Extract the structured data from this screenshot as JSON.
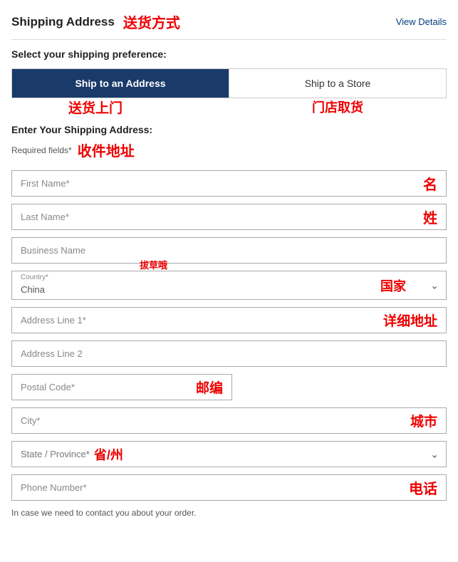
{
  "header": {
    "title": "Shipping Address",
    "chinese_title": "送货方式",
    "view_details": "View Details"
  },
  "shipping_preference": {
    "label": "Select your shipping preference:"
  },
  "options": {
    "ship_to_address": "Ship to an Address",
    "ship_to_address_chinese": "送货上门",
    "ship_to_store": "Ship to a Store",
    "ship_to_store_chinese": "门店取货"
  },
  "form": {
    "title": "Enter Your Shipping Address:",
    "required_note": "Required fields*",
    "required_chinese": "收件地址",
    "first_name_placeholder": "First Name*",
    "first_name_chinese": "名",
    "last_name_placeholder": "Last Name*",
    "last_name_chinese": "姓",
    "business_name_placeholder": "Business Name",
    "country_label": "Country*",
    "country_popup_chinese": "拔草哦",
    "country_value": "China",
    "country_chinese": "国家",
    "address1_placeholder": "Address Line 1*",
    "address1_chinese": "详细地址",
    "address2_placeholder": "Address Line 2",
    "postal_placeholder": "Postal Code*",
    "postal_chinese": "邮编",
    "city_placeholder": "City*",
    "city_chinese": "城市",
    "state_placeholder": "State / Province*",
    "state_chinese": "省/州",
    "phone_placeholder": "Phone Number*",
    "phone_chinese": "电话",
    "phone_note": "In case we need to contact you about your order."
  }
}
